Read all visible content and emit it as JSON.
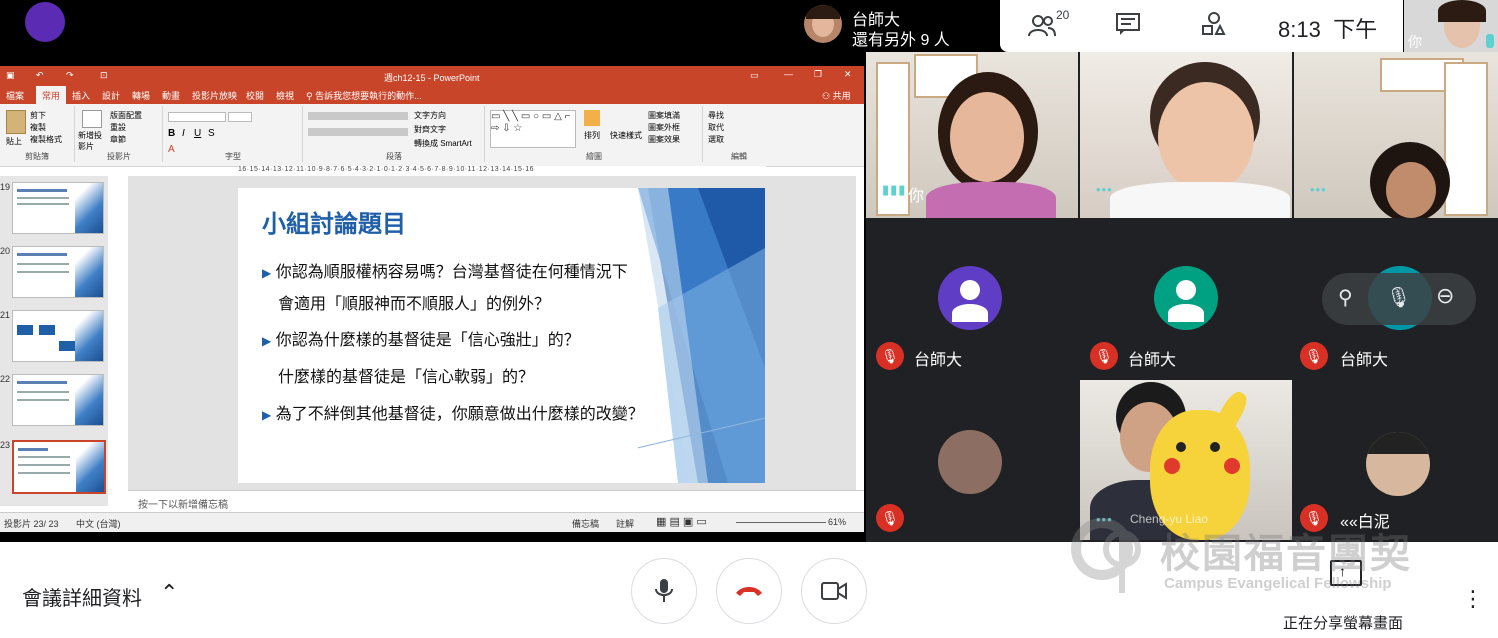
{
  "presenter": {
    "name": "台師大",
    "others": "還有另外 9 人"
  },
  "toolbar": {
    "participants_count": "20",
    "clock": "8:13",
    "period": "下午",
    "self_label": "你"
  },
  "ppt": {
    "window_title": "週ch12-15 - PowerPoint",
    "tabs": [
      "檔案",
      "常用",
      "插入",
      "設計",
      "轉場",
      "動畫",
      "投影片放映",
      "校閱",
      "檢視"
    ],
    "search_hint": "告訴我您想要執行的動作...",
    "share_label": "共用",
    "ribbon_groups": [
      "剪貼簿",
      "投影片",
      "字型",
      "段落",
      "繪圖",
      "編輯"
    ],
    "ribbon_items": {
      "paste": "貼上",
      "cut": "剪下",
      "copy": "複製",
      "format_painter": "複製格式",
      "new_slide": "新增投影片",
      "layout": "版面配置",
      "reset": "重設",
      "section": "章節",
      "text_direction": "文字方向",
      "align_text": "對齊文字",
      "convert_smartart": "轉換成 SmartArt",
      "arrange": "排列",
      "quick_styles": "快速樣式",
      "shape_fill": "圖案填滿",
      "shape_outline": "圖案外框",
      "shape_effects": "圖案效果",
      "find": "尋找",
      "replace": "取代",
      "select": "選取"
    },
    "ruler": "16·15·14·13·12·11·10·9·8·7·6·5·4·3·2·1·0·1·2·3·4·5·6·7·8·9·10·11·12·13·14·15·16",
    "thumbnails": [
      "19",
      "20",
      "21",
      "22",
      "23"
    ],
    "slide": {
      "title": "小組討論題目",
      "lines": [
        "你認為順服權柄容易嗎？台灣基督徒在何種情況下",
        "會適用「順服神而不順服人」的例外？",
        "你認為什麼樣的基督徒是「信心強壯」的？",
        "什麼樣的基督徒是「信心軟弱」的？",
        "為了不絆倒其他基督徒，你願意做出什麼樣的改變？"
      ]
    },
    "notes_hint": "按一下以新增備忘稿",
    "status_slide": "投影片 23/ 23",
    "status_lang": "中文 (台灣)",
    "status_notes": "備忘稿",
    "status_comments": "註解",
    "zoom": "61%"
  },
  "participants": {
    "you_label": "你",
    "tile_name": "台師大",
    "chengyu": "Cheng-yu Liao",
    "baini": "««白泥"
  },
  "bottom": {
    "details": "會議詳細資料",
    "share_label": "正在分享螢幕畫面",
    "watermark_cn": "校園福音團契",
    "watermark_en": "Campus Evangelical Fellowship"
  },
  "colors": {
    "ppt_accent": "#c8452a",
    "mic_off": "#d93025",
    "hangup": "#d93025"
  }
}
